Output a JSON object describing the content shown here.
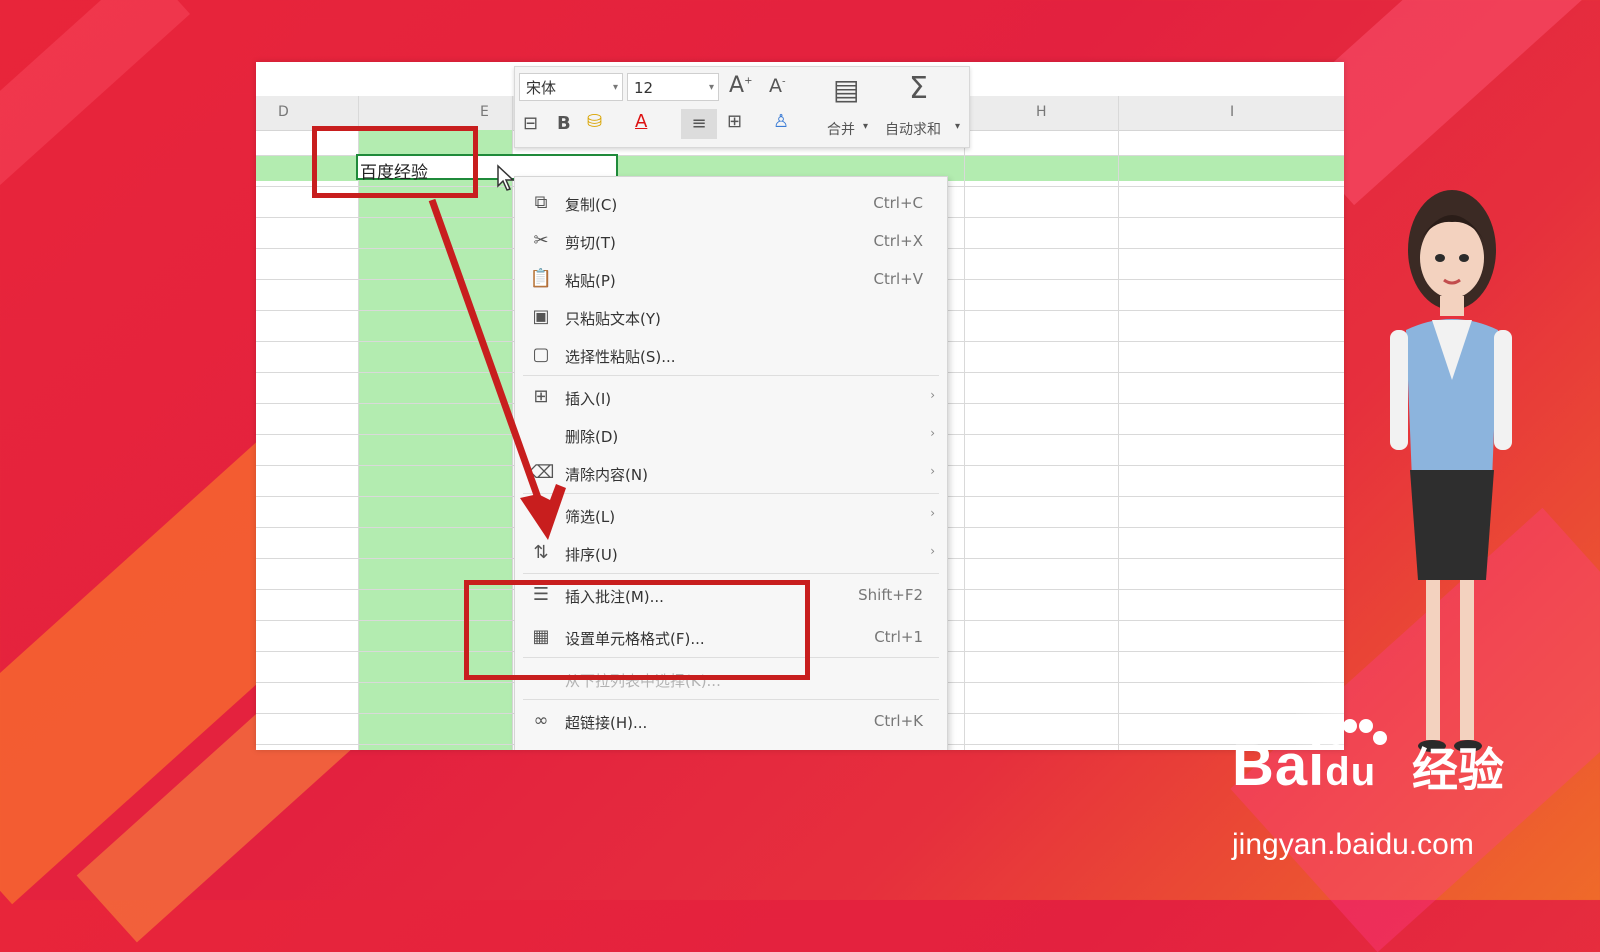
{
  "columns": {
    "d": "D",
    "e": "E",
    "h": "H",
    "i": "I"
  },
  "cell_text": "百度经验",
  "toolbar": {
    "font_name": "宋体",
    "font_size": "12",
    "increase_font": "A",
    "decrease_font": "A",
    "bold": "B",
    "font_color": "A",
    "merge_label": "合并",
    "autosum_label": "自动求和",
    "sigma": "Σ"
  },
  "menu": {
    "items": [
      {
        "label": "复制(C)",
        "shortcut": "Ctrl+C",
        "icon": "copy-icon"
      },
      {
        "label": "剪切(T)",
        "shortcut": "Ctrl+X",
        "icon": "scissors-icon"
      },
      {
        "label": "粘贴(P)",
        "shortcut": "Ctrl+V",
        "icon": "paste-icon"
      },
      {
        "label": "只粘贴文本(Y)",
        "shortcut": "",
        "icon": "paste-text-icon"
      },
      {
        "label": "选择性粘贴(S)...",
        "shortcut": "",
        "icon": "paste-special-icon"
      },
      {
        "label": "插入(I)",
        "shortcut": "",
        "icon": "insert-icon"
      },
      {
        "label": "删除(D)",
        "shortcut": "",
        "icon": ""
      },
      {
        "label": "清除内容(N)",
        "shortcut": "",
        "icon": "eraser-icon"
      },
      {
        "label": "筛选(L)",
        "shortcut": "",
        "icon": "filter-icon"
      },
      {
        "label": "排序(U)",
        "shortcut": "",
        "icon": "sort-icon"
      },
      {
        "label": "插入批注(M)...",
        "shortcut": "Shift+F2",
        "icon": "comment-icon"
      },
      {
        "label": "设置单元格格式(F)...",
        "shortcut": "Ctrl+1",
        "icon": "format-cells-icon"
      },
      {
        "label": "从下拉列表中选择(K)...",
        "shortcut": "",
        "icon": ""
      },
      {
        "label": "超链接(H)...",
        "shortcut": "Ctrl+K",
        "icon": "link-icon"
      }
    ],
    "submenu_arrow": "›"
  },
  "watermark": {
    "brand": "Bai",
    "brand_du": "du",
    "brand_cn": "经验",
    "url": "jingyan.baidu.com"
  },
  "colors": {
    "highlight": "#b3ecb0",
    "annotation_red": "#c81e1e",
    "background": "#e3213f"
  }
}
